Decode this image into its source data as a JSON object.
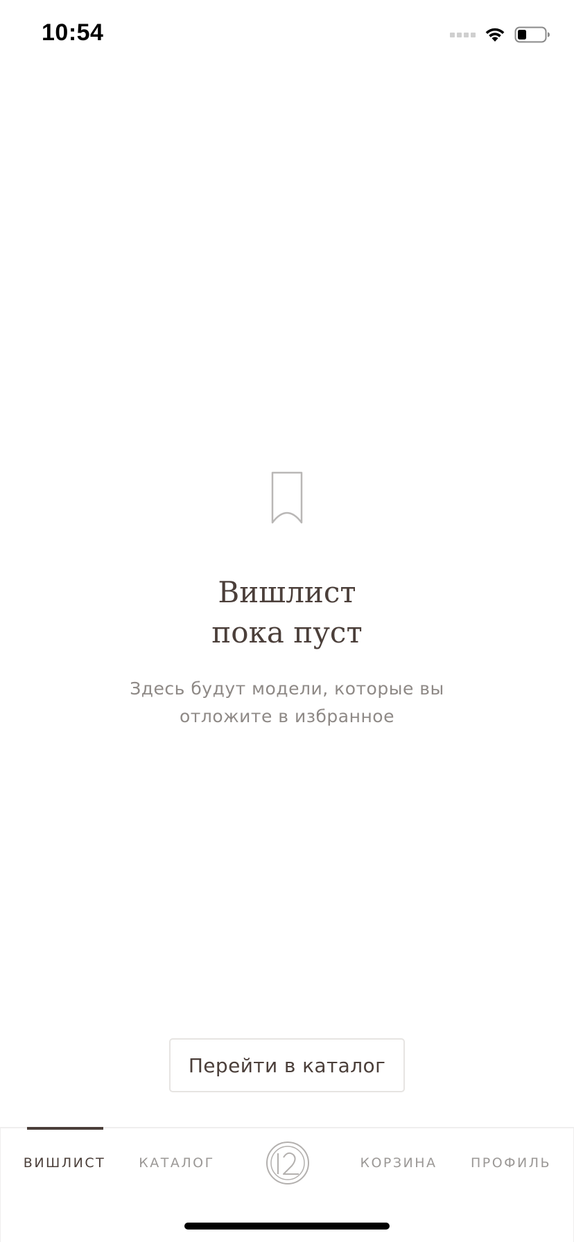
{
  "status_bar": {
    "time": "10:54"
  },
  "empty_state": {
    "icon": "bookmark-icon",
    "title_line1": "Вишлист",
    "title_line2": "пока пуст",
    "subtitle_line1": "Здесь будут модели, которые вы",
    "subtitle_line2": "отложите в избранное"
  },
  "actions": {
    "catalog_button_label": "Перейти в каталог"
  },
  "tab_bar": {
    "active_tab": "wishlist",
    "tabs": [
      {
        "id": "wishlist",
        "label": "ВИШЛИСТ"
      },
      {
        "id": "catalog",
        "label": "КАТАЛОГ"
      },
      {
        "id": "logo",
        "icon": "brand-logo-icon"
      },
      {
        "id": "cart",
        "label": "КОРЗИНА"
      },
      {
        "id": "profile",
        "label": "ПРОФИЛЬ"
      }
    ]
  },
  "colors": {
    "primary_text": "#4b3f3a",
    "secondary_text": "#8e8986",
    "inactive_tab": "#9b9896",
    "border": "#e6e4e2",
    "background": "#ffffff"
  }
}
